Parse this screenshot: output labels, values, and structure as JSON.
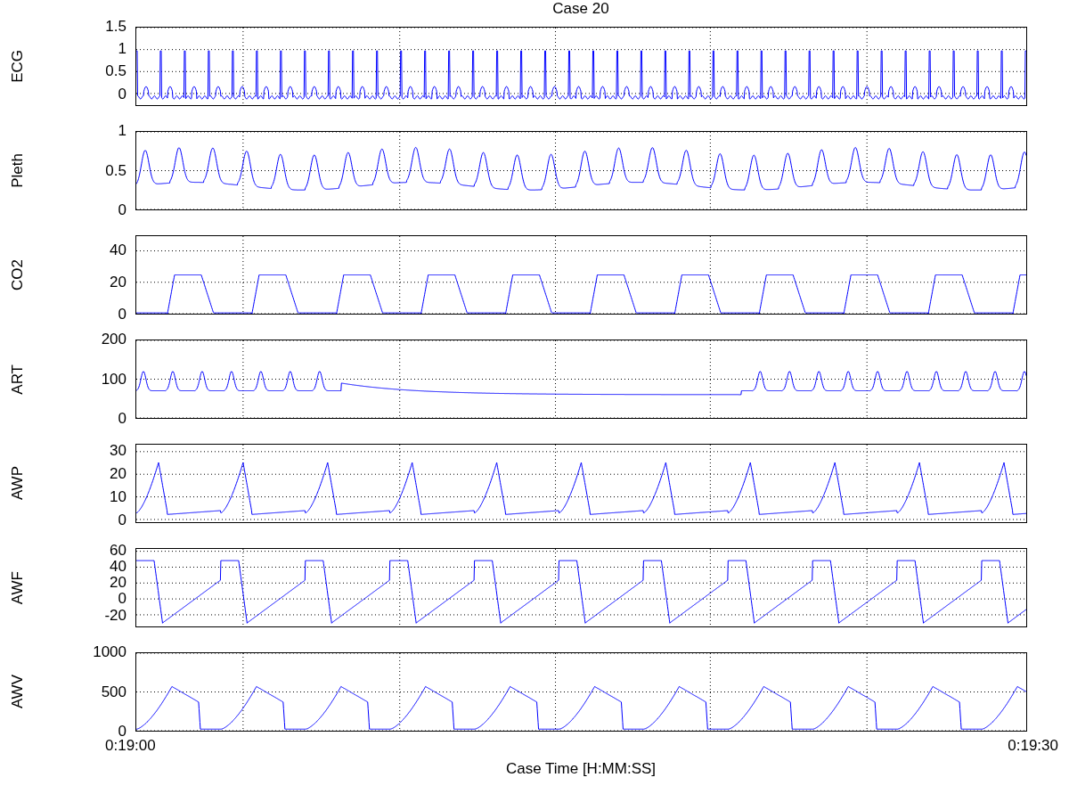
{
  "title": "Case 20",
  "panels": [
    {
      "ylabel": "ECG",
      "yticks": [
        "1.5",
        "1",
        "0.5",
        "0"
      ]
    },
    {
      "ylabel": "Pleth",
      "yticks": [
        "1",
        "0.5",
        "0"
      ]
    },
    {
      "ylabel": "CO2",
      "yticks": [
        "40",
        "20",
        "0"
      ]
    },
    {
      "ylabel": "ART",
      "yticks": [
        "200",
        "100",
        "0"
      ]
    },
    {
      "ylabel": "AWP",
      "yticks": [
        "30",
        "20",
        "10",
        "0"
      ]
    },
    {
      "ylabel": "AWF",
      "yticks": [
        "60",
        "40",
        "20",
        "0",
        "-20"
      ]
    },
    {
      "ylabel": "AWV",
      "yticks": [
        "1000",
        "500",
        "0"
      ]
    }
  ],
  "xticks": [
    "0:19:00",
    "0:19:30"
  ],
  "xlabel": "Case Time [H:MM:SS]"
}
